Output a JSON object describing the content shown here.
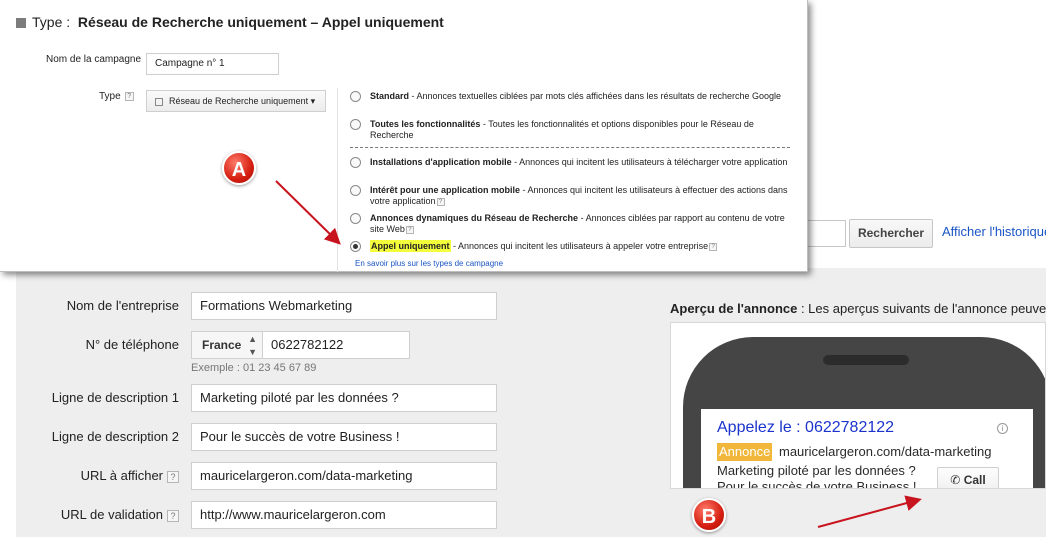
{
  "panel": {
    "title_prefix": "Type :",
    "title": "Réseau de Recherche uniquement – Appel uniquement",
    "campaign_name_label": "Nom de la campagne",
    "campaign_name_value": "Campagne n° 1",
    "type_label": "Type",
    "type_dropdown": "Réseau de Recherche uniquement",
    "options": [
      {
        "name": "Standard",
        "desc": " - Annonces textuelles ciblées par mots clés affichées dans les résultats de recherche Google",
        "selected": false
      },
      {
        "name": "Toutes les fonctionnalités",
        "desc": " - Toutes les fonctionnalités et options disponibles pour le Réseau de Recherche",
        "selected": false
      },
      {
        "name": "Installations d'application mobile",
        "desc": " - Annonces qui incitent les utilisateurs à télécharger votre application",
        "selected": false
      },
      {
        "name": "Intérêt pour une application mobile",
        "desc": " - Annonces qui incitent les utilisateurs à effectuer des actions dans votre application",
        "selected": false
      },
      {
        "name": "Annonces dynamiques du Réseau de Recherche",
        "desc": " - Annonces ciblées par rapport au contenu de votre site Web",
        "selected": false
      },
      {
        "name": "Appel uniquement",
        "desc": " - Annonces qui incitent les utilisateurs à appeler votre entreprise",
        "selected": true
      }
    ],
    "learn_more": "En savoir plus sur les types de campagne"
  },
  "background": {
    "search_button": "Rechercher",
    "history_link": "Afficher l'historique"
  },
  "form": {
    "company_label": "Nom de l'entreprise",
    "company_value": "Formations Webmarketing",
    "phone_label": "N° de téléphone",
    "country": "France",
    "phone_value": "0622782122",
    "phone_example": "Exemple : 01 23 45 67 89",
    "desc1_label": "Ligne de description 1",
    "desc1_value": "Marketing piloté par les données ?",
    "desc2_label": "Ligne de description 2",
    "desc2_value": "Pour le succès de votre Business !",
    "display_url_label": "URL à afficher",
    "display_url_value": "mauricelargeron.com/data-marketing",
    "validation_url_label": "URL de validation",
    "validation_url_value": "http://www.mauricelargeron.com"
  },
  "preview": {
    "title_bold": "Aperçu de l'annonce",
    "title_rest": " : Les aperçus suivants de l'annonce peuve",
    "headline": "Appelez le : 0622782122",
    "badge": "Annonce",
    "url": "mauricelargeron.com/data-marketing",
    "line1": "Marketing piloté par les données ?",
    "line2": "Pour le succès de votre Business !",
    "call_button": "Call"
  },
  "markers": {
    "a": "A",
    "b": "B"
  },
  "colors": {
    "accent": "#1a33cc",
    "badge": "#f0b73b",
    "highlight": "#f4ff3b",
    "arrow": "#c8141e"
  },
  "icons": [
    "search-icon",
    "help-icon",
    "dropdown-icon",
    "info-icon",
    "phone-icon"
  ]
}
